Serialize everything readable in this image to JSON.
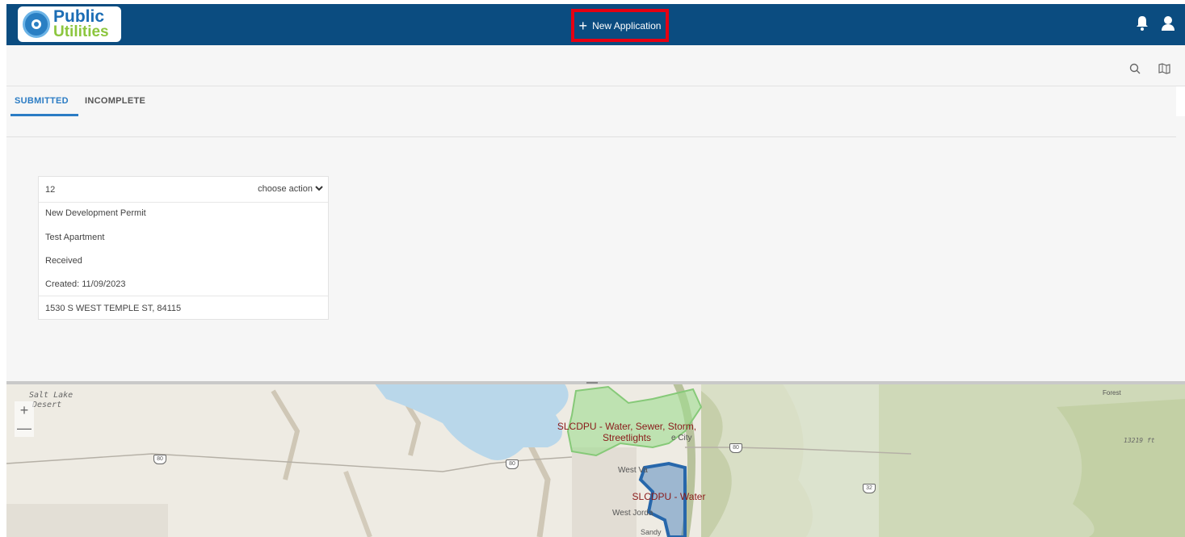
{
  "header": {
    "logo": {
      "line1": "Public",
      "line2": "Utilities"
    },
    "new_application_label": "New Application"
  },
  "tabs": [
    {
      "label": "SUBMITTED",
      "active": true
    },
    {
      "label": "INCOMPLETE",
      "active": false
    }
  ],
  "card": {
    "id": "12",
    "action_label": "choose action",
    "type": "New Development Permit",
    "name": "Test Apartment",
    "status": "Received",
    "created": "Created: 11/09/2023",
    "address": "1530 S WEST TEMPLE ST, 84115"
  },
  "map": {
    "zoom_in": "+",
    "zoom_out": "—",
    "labels": {
      "salt_lake": "Salt Lake",
      "desert": "Desert",
      "forest": "Forest",
      "elevation": "13219 ft",
      "west_valley": "West Va",
      "west_jordan": "West Jorda",
      "sandy": "Sandy",
      "city": "e City"
    },
    "highways": [
      "80",
      "80",
      "80",
      "32"
    ],
    "districts": [
      {
        "line1": "SLCDPU - Water, Sewer, Storm,",
        "line2": "Streetlights"
      },
      {
        "label": "SLCDPU - Water"
      }
    ]
  },
  "icons": [
    "bell-icon",
    "user-icon",
    "search-icon",
    "map-icon",
    "chevron-down-icon",
    "plus-icon"
  ],
  "colors": {
    "header_bg": "#0b4c80",
    "accent": "#2b7cc4",
    "highlight": "#e60012",
    "district_green": "#9fdc8f",
    "district_blue": "#3a78b8"
  }
}
